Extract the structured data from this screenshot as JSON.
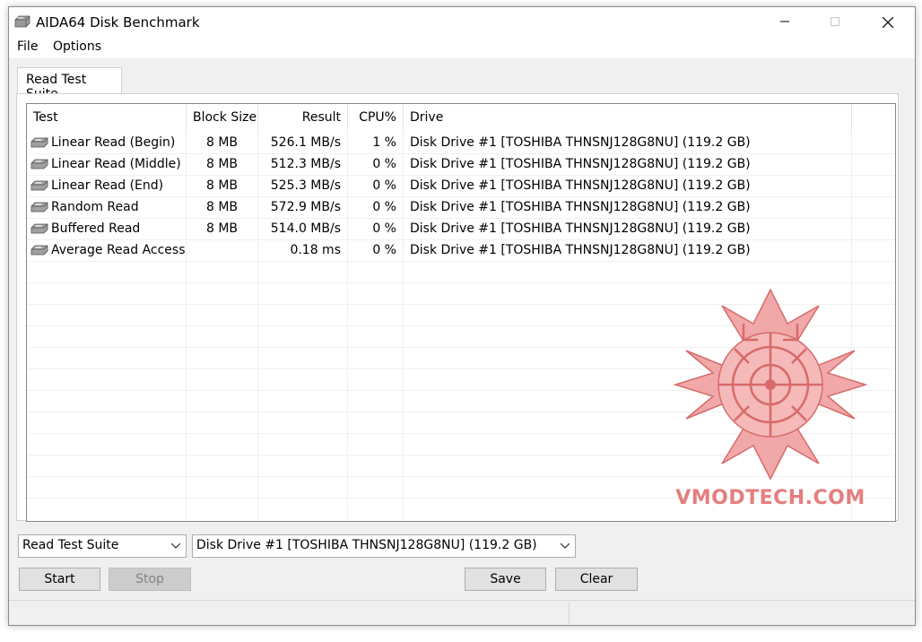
{
  "window": {
    "title": "AIDA64 Disk Benchmark"
  },
  "menu": {
    "items": [
      "File",
      "Options"
    ]
  },
  "tabs": [
    {
      "label": "Read Test Suite"
    }
  ],
  "table": {
    "columns": [
      "Test",
      "Block Size",
      "Result",
      "CPU%",
      "Drive"
    ],
    "rows": [
      {
        "test": "Linear Read (Begin)",
        "block": "8 MB",
        "result": "526.1 MB/s",
        "cpu": "1 %",
        "drive": "Disk Drive #1  [TOSHIBA THNSNJ128G8NU]  (119.2 GB)"
      },
      {
        "test": "Linear Read (Middle)",
        "block": "8 MB",
        "result": "512.3 MB/s",
        "cpu": "0 %",
        "drive": "Disk Drive #1  [TOSHIBA THNSNJ128G8NU]  (119.2 GB)"
      },
      {
        "test": "Linear Read (End)",
        "block": "8 MB",
        "result": "525.3 MB/s",
        "cpu": "0 %",
        "drive": "Disk Drive #1  [TOSHIBA THNSNJ128G8NU]  (119.2 GB)"
      },
      {
        "test": "Random Read",
        "block": "8 MB",
        "result": "572.9 MB/s",
        "cpu": "0 %",
        "drive": "Disk Drive #1  [TOSHIBA THNSNJ128G8NU]  (119.2 GB)"
      },
      {
        "test": "Buffered Read",
        "block": "8 MB",
        "result": "514.0 MB/s",
        "cpu": "0 %",
        "drive": "Disk Drive #1  [TOSHIBA THNSNJ128G8NU]  (119.2 GB)"
      },
      {
        "test": "Average Read Access",
        "block": "",
        "result": "0.18 ms",
        "cpu": "0 %",
        "drive": "Disk Drive #1  [TOSHIBA THNSNJ128G8NU]  (119.2 GB)"
      }
    ],
    "row_icon": "hard-disk-icon"
  },
  "watermark": {
    "text": "VMODTECH.COM",
    "color": "#e57e7e"
  },
  "controls": {
    "suite_select": "Read Test Suite",
    "drive_select": "Disk Drive #1  [TOSHIBA THNSNJ128G8NU]  (119.2 GB)",
    "start_label": "Start",
    "stop_label": "Stop",
    "save_label": "Save",
    "clear_label": "Clear"
  }
}
